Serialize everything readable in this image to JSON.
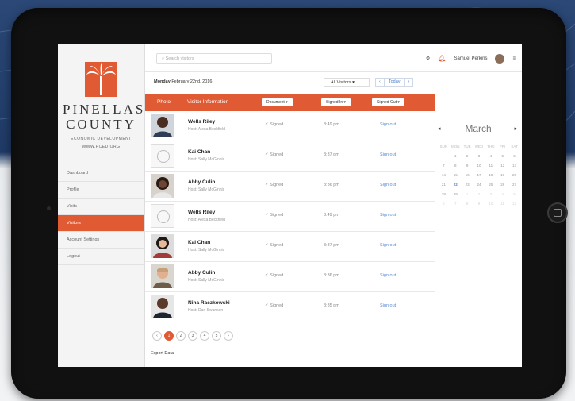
{
  "brand": {
    "name_line1": "PINELLAS",
    "name_line2": "COUNTY",
    "tagline": "ECONOMIC DEVELOPMENT",
    "url": "WWW.PCED.ORG",
    "accent": "#e05a33"
  },
  "sidebar": {
    "items": [
      {
        "label": "Dashboard"
      },
      {
        "label": "Profile"
      },
      {
        "label": "Visits"
      },
      {
        "label": "Visitors"
      },
      {
        "label": "Account Settings"
      },
      {
        "label": "Logout"
      }
    ],
    "active": "Visitors"
  },
  "topbar": {
    "search_placeholder": "Search visitors",
    "user_name": "Samuel Perkins",
    "icons": [
      "search-icon",
      "gear-icon",
      "bell-icon",
      "menu-icon"
    ]
  },
  "datebar": {
    "day": "Monday",
    "date": "February 22nd, 2016",
    "filter": "All Visitors",
    "today_label": "Today"
  },
  "table": {
    "headers": {
      "photo": "Photo",
      "info": "Visitor Information",
      "document": "Document",
      "signed_in": "Signed In",
      "signed_out": "Signed Out"
    },
    "rows": [
      {
        "name": "Wells Riley",
        "host": "Host: Alexa Beckfield",
        "status": "✓ Signed",
        "time": "3:49 pm",
        "action": "Sign out",
        "photo": "person"
      },
      {
        "name": "Kai Chan",
        "host": "Host: Sally McGinnis",
        "status": "✓ Signed",
        "time": "3:37 pm",
        "action": "Sign out",
        "photo": "placeholder"
      },
      {
        "name": "Abby Culin",
        "host": "Host: Sally McGinnis",
        "status": "✓ Signed",
        "time": "3:36 pm",
        "action": "Sign out",
        "photo": "person"
      },
      {
        "name": "Wells Riley",
        "host": "Host: Alexa Beckfield",
        "status": "✓ Signed",
        "time": "3:49 pm",
        "action": "Sign out",
        "photo": "placeholder"
      },
      {
        "name": "Kai Chan",
        "host": "Host: Sally McGinnis",
        "status": "✓ Signed",
        "time": "3:37 pm",
        "action": "Sign out",
        "photo": "person"
      },
      {
        "name": "Abby Culin",
        "host": "Host: Sally McGinnis",
        "status": "✓ Signed",
        "time": "3:36 pm",
        "action": "Sign out",
        "photo": "person"
      },
      {
        "name": "Nina Raczkowski",
        "host": "Host: Dan Swanson",
        "status": "✓ Signed",
        "time": "3:35 pm",
        "action": "Sign out",
        "photo": "person"
      }
    ]
  },
  "calendar": {
    "month": "March",
    "weekdays": [
      "SUN",
      "MON",
      "TUE",
      "WED",
      "THU",
      "FRI",
      "SAT"
    ],
    "days": [
      "",
      "1",
      "2",
      "3",
      "4",
      "5",
      "6",
      "7",
      "8",
      "9",
      "10",
      "11",
      "12",
      "13",
      "14",
      "15",
      "16",
      "17",
      "18",
      "19",
      "20",
      "21",
      "22",
      "23",
      "24",
      "25",
      "26",
      "27",
      "28",
      "29",
      "1",
      "2",
      "3",
      "4",
      "5",
      "6",
      "7",
      "8",
      "9",
      "10",
      "11",
      "12"
    ],
    "today": "22"
  },
  "pagination": {
    "pages": [
      "‹",
      "1",
      "2",
      "3",
      "4",
      "5",
      "›"
    ],
    "current": "1"
  },
  "export_label": "Export Data"
}
